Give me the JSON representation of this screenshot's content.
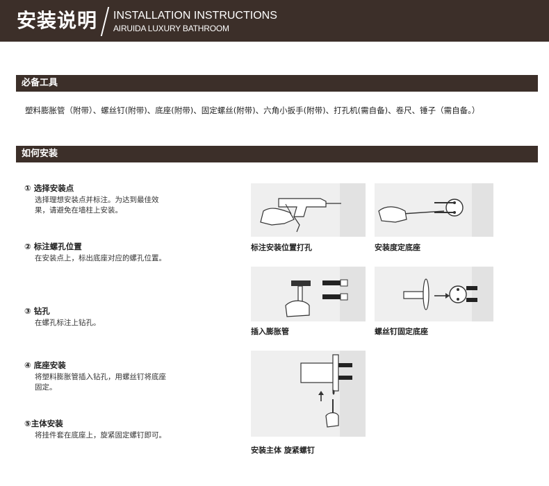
{
  "header": {
    "title_zh": "安装说明",
    "title_en": "INSTALLATION INSTRUCTIONS",
    "subtitle_en": "AIRUIDA LUXURY BATHROOM"
  },
  "tools": {
    "heading": "必备工具",
    "text": "塑料膨胀管（附带）、螺丝钉(附带)、底座(附带)、固定螺丝(附带)、六角小扳手(附带)、打孔机(需自备)、卷尺、锤子（需自备。）"
  },
  "install": {
    "heading": "如何安装",
    "steps": [
      {
        "title": "① 选择安装点",
        "desc": "选择理想安装点并标注。为达到最佳效果，请避免在墙柱上安装。"
      },
      {
        "title": "② 标注螺孔位置",
        "desc": "在安装点上，标出底座对应的螺孔位置。"
      },
      {
        "title": "③ 钻孔",
        "desc": "在螺孔标注上钻孔。"
      },
      {
        "title": "④ 底座安装",
        "desc": "将塑料膨胀管插入钻孔，用螺丝钉将底座固定。"
      },
      {
        "title": "⑤主体安装",
        "desc": "将挂件套在底座上，旋紧固定螺钉即可。"
      }
    ],
    "captions": [
      "标注安装位置打孔",
      "安装度定底座",
      "插入膨胀管",
      "螺丝钉固定底座",
      "安装主体 旋紧螺钉"
    ]
  },
  "icons": [
    "drill-illustration",
    "screwdriver-illustration",
    "hammer-illustration",
    "base-screw-illustration",
    "mount-body-illustration"
  ],
  "colors": {
    "header_bg": "#3c2f29",
    "panel_bg": "#efefef"
  }
}
